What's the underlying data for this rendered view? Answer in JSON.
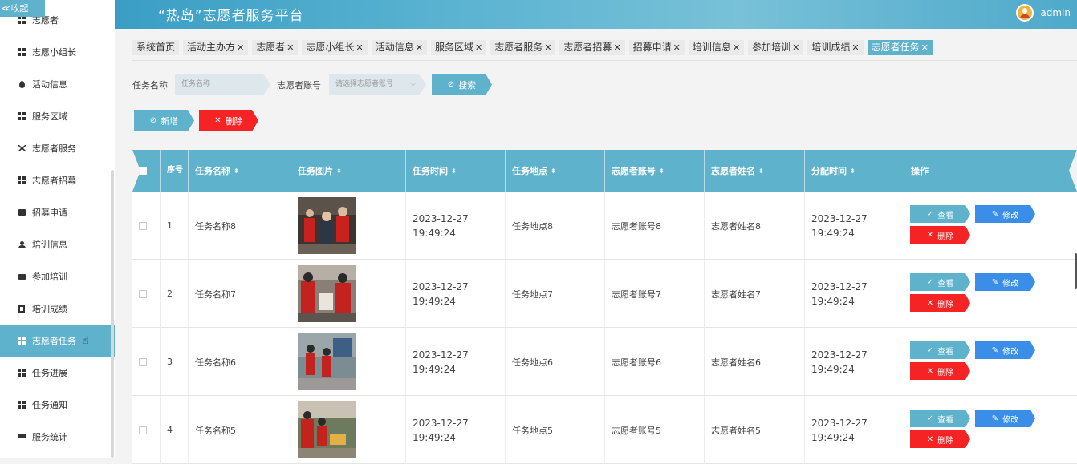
{
  "sidebar": {
    "collapse_label": "≪收起",
    "items": [
      {
        "label": "志愿者",
        "icon": "grid-icon"
      },
      {
        "label": "志愿小组长",
        "icon": "grid-icon"
      },
      {
        "label": "活动信息",
        "icon": "location-pin-icon"
      },
      {
        "label": "服务区域",
        "icon": "grid-icon"
      },
      {
        "label": "志愿者服务",
        "icon": "tools-icon"
      },
      {
        "label": "志愿者招募",
        "icon": "grid-icon"
      },
      {
        "label": "招募申请",
        "icon": "briefcase-icon"
      },
      {
        "label": "培训信息",
        "icon": "user-icon"
      },
      {
        "label": "参加培训",
        "icon": "message-icon"
      },
      {
        "label": "培训成绩",
        "icon": "document-icon"
      },
      {
        "label": "志愿者任务",
        "icon": "grid-icon"
      },
      {
        "label": "任务进展",
        "icon": "grid-icon"
      },
      {
        "label": "任务通知",
        "icon": "grid-icon"
      },
      {
        "label": "服务统计",
        "icon": "monitor-icon"
      }
    ],
    "active_index": 10
  },
  "header": {
    "title": "“热岛”志愿者服务平台",
    "username": "admin"
  },
  "tabs": [
    {
      "label": "系统首页",
      "closable": false
    },
    {
      "label": "活动主办方",
      "closable": true
    },
    {
      "label": "志愿者",
      "closable": true
    },
    {
      "label": "志愿小组长",
      "closable": true
    },
    {
      "label": "活动信息",
      "closable": true
    },
    {
      "label": "服务区域",
      "closable": true
    },
    {
      "label": "志愿者服务",
      "closable": true
    },
    {
      "label": "志愿者招募",
      "closable": true
    },
    {
      "label": "招募申请",
      "closable": true
    },
    {
      "label": "培训信息",
      "closable": true
    },
    {
      "label": "参加培训",
      "closable": true
    },
    {
      "label": "培训成绩",
      "closable": true
    },
    {
      "label": "志愿者任务",
      "closable": true,
      "active": true
    }
  ],
  "search": {
    "task_name_label": "任务名称",
    "task_name_placeholder": "任务名称",
    "account_label": "志愿者账号",
    "account_placeholder": "请选择志愿者账号",
    "search_button": "搜索"
  },
  "actions": {
    "add_button": "新增",
    "delete_button": "删除"
  },
  "table": {
    "headers": [
      "序号",
      "任务名称",
      "任务图片",
      "任务时间",
      "任务地点",
      "志愿者账号",
      "志愿者姓名",
      "分配时间",
      "操作"
    ],
    "op_labels": {
      "view": "查看",
      "edit": "修改",
      "delete": "删除"
    },
    "rows": [
      {
        "index": "1",
        "name": "任务名称8",
        "time": "2023-12-27 19:49:24",
        "location": "任务地点8",
        "account": "志愿者账号8",
        "volunteer": "志愿者姓名8",
        "assigned": "2023-12-27 19:49:24"
      },
      {
        "index": "2",
        "name": "任务名称7",
        "time": "2023-12-27 19:49:24",
        "location": "任务地点7",
        "account": "志愿者账号7",
        "volunteer": "志愿者姓名7",
        "assigned": "2023-12-27 19:49:24"
      },
      {
        "index": "3",
        "name": "任务名称6",
        "time": "2023-12-27 19:49:24",
        "location": "任务地点6",
        "account": "志愿者账号6",
        "volunteer": "志愿者姓名6",
        "assigned": "2023-12-27 19:49:24"
      },
      {
        "index": "4",
        "name": "任务名称5",
        "time": "2023-12-27 19:49:24",
        "location": "任务地点5",
        "account": "志愿者账号5",
        "volunteer": "志愿者姓名5",
        "assigned": "2023-12-27 19:49:24"
      }
    ]
  },
  "colors": {
    "accent": "#5fb2cc",
    "danger": "#f52323",
    "edit": "#3b8ee8"
  }
}
